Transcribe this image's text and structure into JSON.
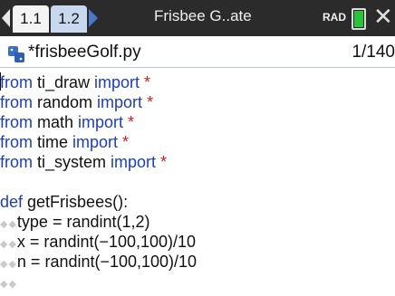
{
  "header": {
    "tabs": [
      {
        "label": "1.1"
      },
      {
        "label": "1.2"
      }
    ],
    "doc_title": "Frisbee G..ate",
    "mode": "RAD"
  },
  "file": {
    "name": "*frisbeeGolf.py",
    "line_info": "1/140",
    "icon": "python-icon"
  },
  "code": {
    "lines": [
      {
        "kw": "from",
        "rest": " ti_draw ",
        "kw2": "import",
        "tail": " *"
      },
      {
        "kw": "from",
        "rest": " random ",
        "kw2": "import",
        "tail": " *"
      },
      {
        "kw": "from",
        "rest": " math ",
        "kw2": "import",
        "tail": " *"
      },
      {
        "kw": "from",
        "rest": " time ",
        "kw2": "import",
        "tail": " *"
      },
      {
        "kw": "from",
        "rest": " ti_system ",
        "kw2": "import",
        "tail": " *"
      },
      {
        "kw": "",
        "rest": "",
        "kw2": "",
        "tail": ""
      },
      {
        "kw": "def",
        "rest": " getFrisbees():",
        "kw2": "",
        "tail": ""
      },
      {
        "indent": "◆◆",
        "text": "type = randint(1,2)"
      },
      {
        "indent": "◆◆",
        "text": "x = randint(−100,100)/10"
      },
      {
        "indent": "◆◆",
        "text": "n = randint(−100,100)/10"
      },
      {
        "indent": "◆◆",
        "text": ""
      }
    ]
  },
  "colors": {
    "keyword": "#1c3fb9",
    "star": "#d32020",
    "topbar": "#2b2b2b",
    "battery": "#29c43a"
  }
}
